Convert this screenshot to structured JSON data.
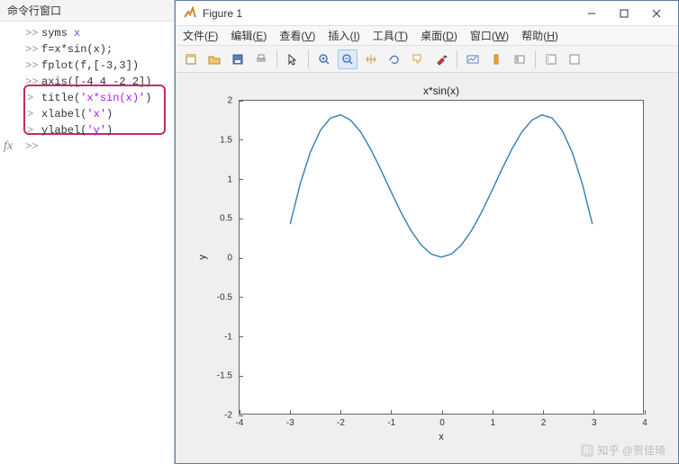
{
  "cmdwin": {
    "title": "命令行窗口",
    "prompt_double": ">>",
    "prompt_single": ">",
    "fx": "fx",
    "lines": [
      {
        "pre": "syms ",
        "sym": "x",
        "post": ""
      },
      {
        "pre": "f=x*sin(x);",
        "sym": "",
        "post": ""
      },
      {
        "pre": "fplot(f,[-3,3])",
        "sym": "",
        "post": ""
      },
      {
        "pre": "axis([-4 4 -2 2])",
        "sym": "",
        "post": ""
      }
    ],
    "hl": [
      {
        "pre": "title(",
        "str": "'x*sin(x)'",
        "post": ")"
      },
      {
        "pre": "xlabel(",
        "str": "'x'",
        "post": ")"
      },
      {
        "pre": "ylabel(",
        "str": "'y'",
        "post": ")"
      }
    ]
  },
  "figure": {
    "title": "Figure 1",
    "menus": {
      "file": "文件",
      "file_u": "F",
      "edit": "编辑",
      "edit_u": "E",
      "view": "查看",
      "view_u": "V",
      "insert": "插入",
      "insert_u": "I",
      "tools": "工具",
      "tools_u": "T",
      "desktop": "桌面",
      "desktop_u": "D",
      "window": "窗口",
      "window_u": "W",
      "help": "帮助",
      "help_u": "H"
    }
  },
  "chart_data": {
    "type": "line",
    "title": "x*sin(x)",
    "xlabel": "x",
    "ylabel": "y",
    "xlim": [
      -4,
      4
    ],
    "ylim": [
      -2,
      2
    ],
    "xticks": [
      -4,
      -3,
      -2,
      -1,
      0,
      1,
      2,
      3,
      4
    ],
    "yticks": [
      -2,
      -1.5,
      -1,
      -0.5,
      0,
      0.5,
      1,
      1.5,
      2
    ],
    "series": [
      {
        "name": "x*sin(x)",
        "color": "#2f7fb7",
        "x": [
          -3.0,
          -2.8,
          -2.6,
          -2.4,
          -2.2,
          -2.0,
          -1.8,
          -1.6,
          -1.4,
          -1.2,
          -1.0,
          -0.8,
          -0.6,
          -0.4,
          -0.2,
          0.0,
          0.2,
          0.4,
          0.6,
          0.8,
          1.0,
          1.2,
          1.4,
          1.6,
          1.8,
          2.0,
          2.2,
          2.4,
          2.6,
          2.8,
          3.0
        ],
        "y": [
          0.42336,
          0.93872,
          1.34157,
          1.62111,
          1.77954,
          1.81859,
          1.75293,
          1.59983,
          1.37961,
          1.11845,
          0.84147,
          0.57388,
          0.33879,
          0.15577,
          0.03973,
          0.0,
          0.03973,
          0.15577,
          0.33879,
          0.57388,
          0.84147,
          1.11845,
          1.37961,
          1.59983,
          1.75293,
          1.81859,
          1.77954,
          1.62111,
          1.34157,
          0.93872,
          0.42336
        ]
      }
    ]
  },
  "watermark": "知乎 @贺佳琦"
}
